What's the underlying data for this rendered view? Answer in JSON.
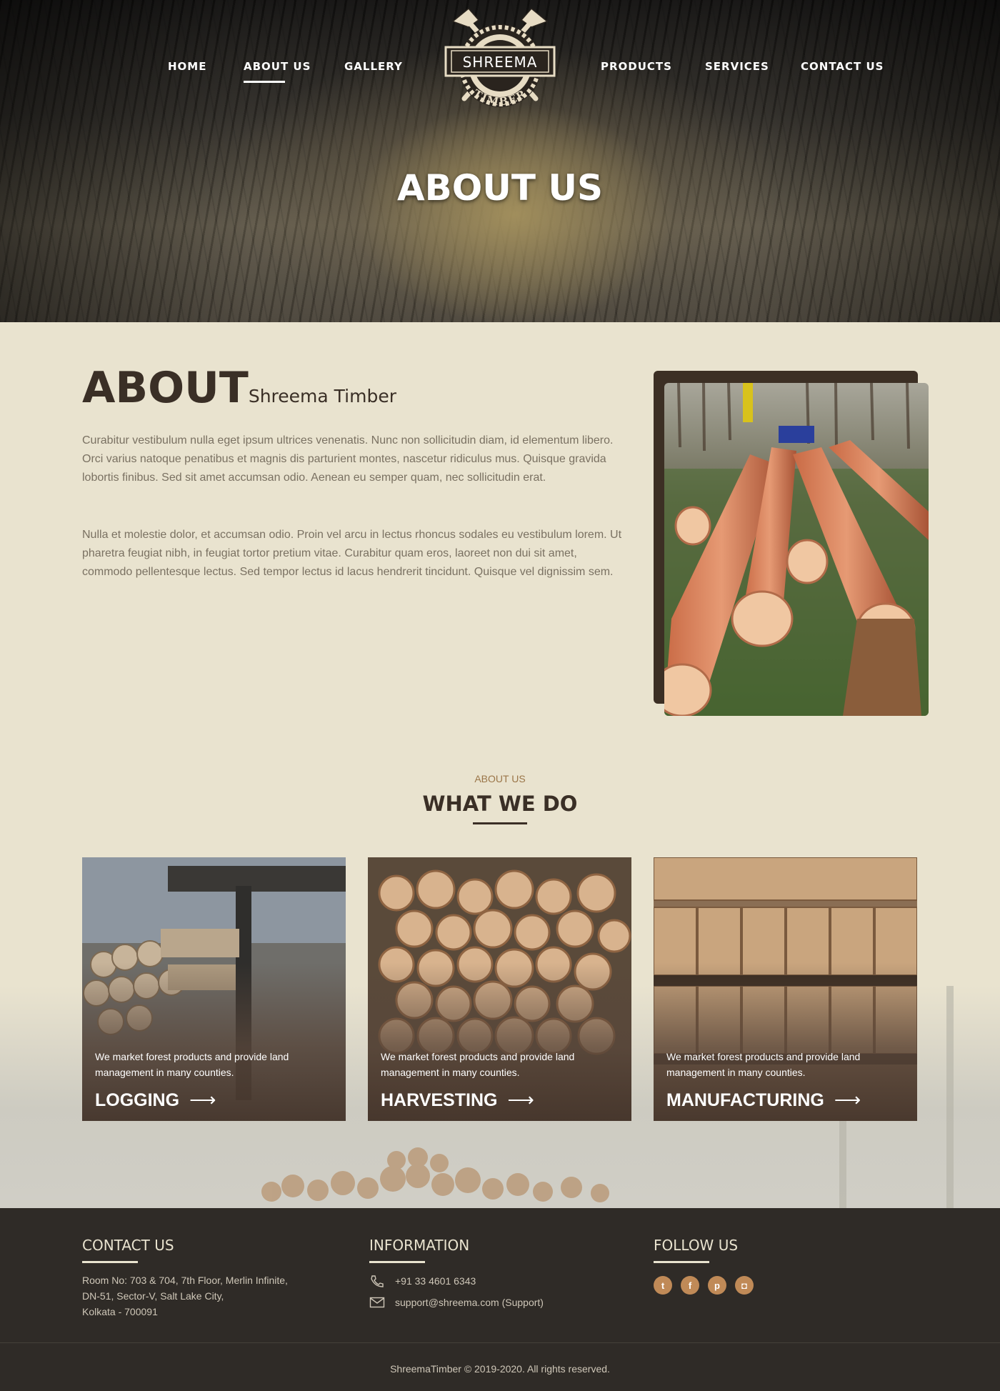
{
  "nav": {
    "items": [
      {
        "label": "HOME"
      },
      {
        "label": "ABOUT US",
        "active": true
      },
      {
        "label": "GALLERY"
      },
      {
        "label": "PRODUCTS"
      },
      {
        "label": "SERVICES"
      },
      {
        "label": "CONTACT US"
      }
    ]
  },
  "logo": {
    "name": "SHREEMA",
    "sub": "TIMBER"
  },
  "hero": {
    "title": "ABOUT US"
  },
  "about": {
    "title_big": "ABOUT",
    "title_small": "Shreema Timber",
    "paragraph1": "Curabitur vestibulum nulla eget ipsum ultrices venenatis. Nunc non sollicitudin diam, id elementum libero. Orci varius natoque penatibus et magnis dis parturient montes, nascetur ridiculus mus. Quisque gravida lobortis finibus. Sed sit amet accumsan odio. Aenean eu semper quam, nec sollicitudin erat.",
    "paragraph2": "Nulla et molestie dolor, et accumsan odio. Proin vel arcu in lectus rhoncus sodales eu vestibulum lorem. Ut pharetra feugiat nibh, in feugiat tortor pretium vitae. Curabitur quam eros, laoreet non dui sit amet, commodo pellentesque lectus. Sed tempor lectus id lacus hendrerit tincidunt. Quisque vel dignissim sem."
  },
  "what_we_do": {
    "eyebrow": "ABOUT US",
    "title": "WHAT WE DO",
    "cards": [
      {
        "title": "LOGGING",
        "description": "We market forest products and provide land management in many counties."
      },
      {
        "title": "HARVESTING",
        "description": "We market forest products and provide land management in many counties."
      },
      {
        "title": "MANUFACTURING",
        "description": "We market forest products and provide land management in many counties."
      }
    ]
  },
  "footer": {
    "contact": {
      "heading": "CONTACT US",
      "address_line1": "Room No: 703 & 704, 7th Floor, Merlin Infinite,",
      "address_line2": "DN-51, Sector-V, Salt Lake City,",
      "address_line3": "Kolkata - 700091"
    },
    "information": {
      "heading": "INFORMATION",
      "phone": "+91 33 4601 6343",
      "email": "support@shreema.com (Support)"
    },
    "follow": {
      "heading": "FOLLOW US",
      "icons": [
        "twitter-icon",
        "facebook-icon",
        "pinterest-icon",
        "instagram-icon"
      ]
    },
    "copyright": "ShreemaTimber © 2019-2020. All rights reserved."
  },
  "colors": {
    "accent": "#c08a57",
    "dark": "#2f2b27",
    "page_bg": "#e9e3cf",
    "heading": "#3a2f26"
  }
}
